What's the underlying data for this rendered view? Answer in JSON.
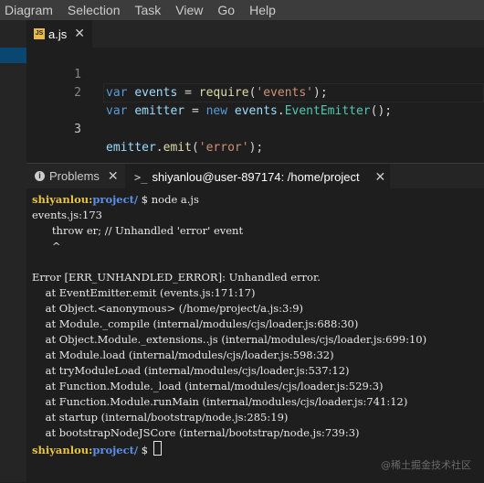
{
  "menu": [
    "Diagram",
    "Selection",
    "Task",
    "View",
    "Go",
    "Help"
  ],
  "editor": {
    "tab": {
      "icon": "js-file-icon",
      "label": "a.js"
    },
    "lines": [
      {
        "no": "1",
        "text": "var events = require('events');"
      },
      {
        "no": "2",
        "text": "var emitter = new events.EventEmitter();"
      },
      {
        "no": "3",
        "text": "emitter.emit('error');"
      }
    ]
  },
  "panel": {
    "tabs": [
      {
        "label": "Problems"
      },
      {
        "label": "shiyanlou@user-897174: /home/project"
      }
    ],
    "terminal_icon": ">_"
  },
  "terminal": {
    "prompt_user": "shiyanlou",
    "prompt_sep": ":",
    "prompt_path": "project/",
    "prompt_symbol": " $ ",
    "command": "node a.js",
    "output": [
      "events.js:173",
      "      throw er; // Unhandled 'error' event",
      "      ^",
      "",
      "Error [ERR_UNHANDLED_ERROR]: Unhandled error.",
      "    at EventEmitter.emit (events.js:171:17)",
      "    at Object.<anonymous> (/home/project/a.js:3:9)",
      "    at Module._compile (internal/modules/cjs/loader.js:688:30)",
      "    at Object.Module._extensions..js (internal/modules/cjs/loader.js:699:10)",
      "    at Module.load (internal/modules/cjs/loader.js:598:32)",
      "    at tryModuleLoad (internal/modules/cjs/loader.js:537:12)",
      "    at Function.Module._load (internal/modules/cjs/loader.js:529:3)",
      "    at Function.Module.runMain (internal/modules/cjs/loader.js:741:12)",
      "    at startup (internal/bootstrap/node.js:285:19)",
      "    at bootstrapNodeJSCore (internal/bootstrap/node.js:739:3)"
    ]
  },
  "watermark": "@稀土掘金技术社区",
  "colors": {
    "accent": "#094771",
    "prompt_user": "#e8c33f",
    "prompt_path": "#5c8fe6"
  }
}
